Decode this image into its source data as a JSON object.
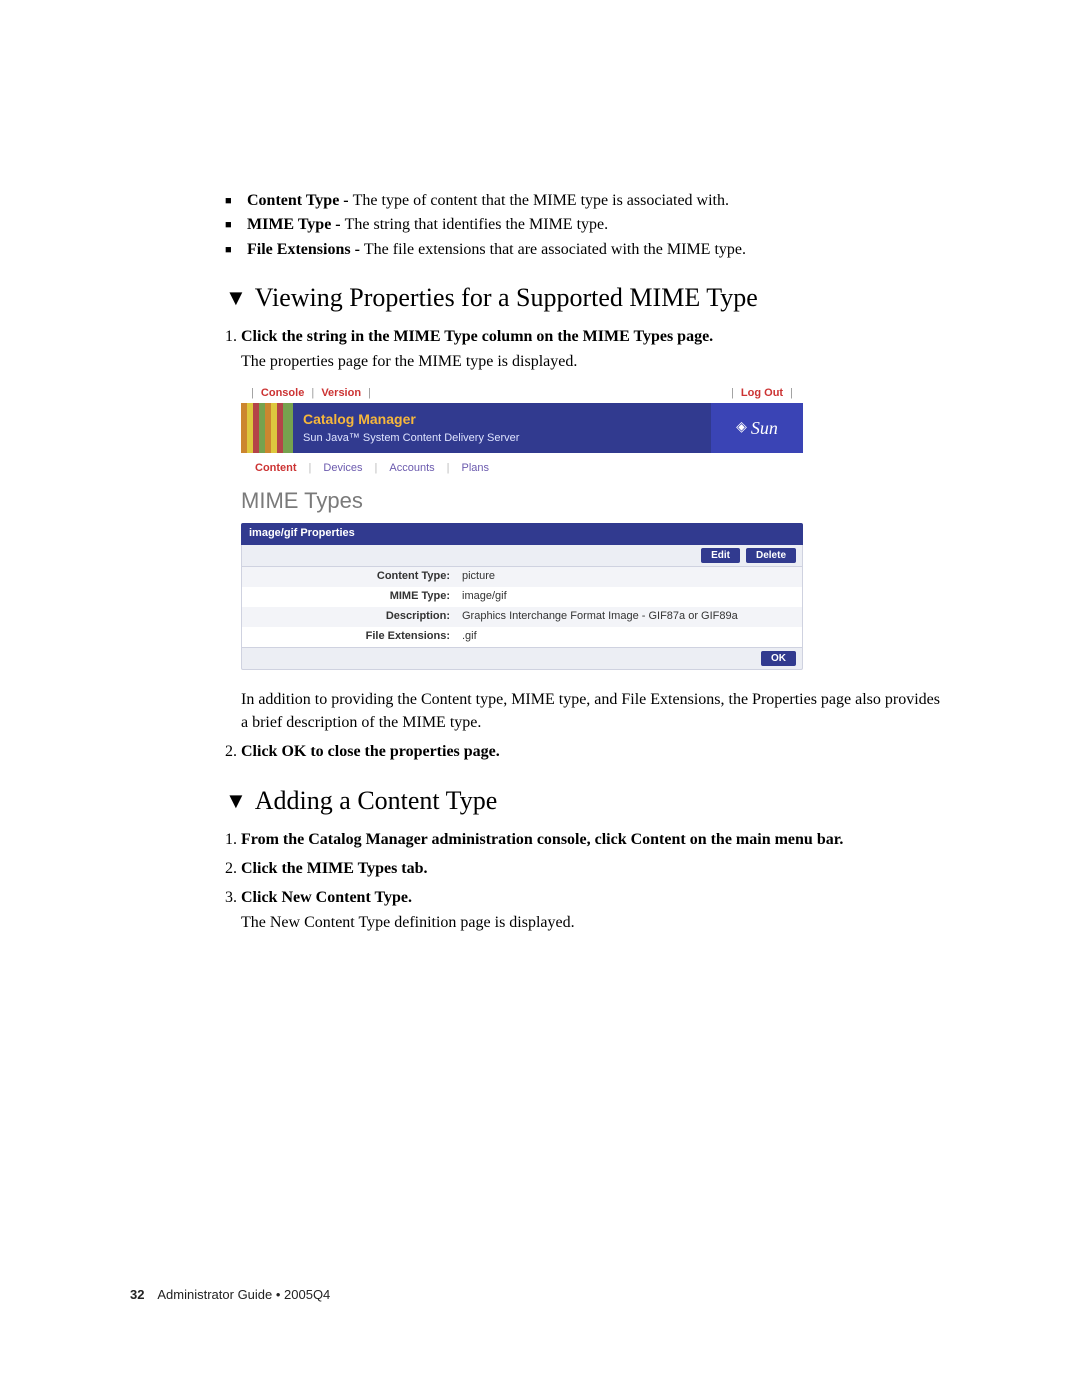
{
  "bullets": [
    {
      "label": "Content Type - ",
      "text": "The type of content that the MIME type is associated with."
    },
    {
      "label": "MIME Type - ",
      "text": "The string that identifies the MIME type."
    },
    {
      "label": "File Extensions - ",
      "text": "The file extensions that are associated with the MIME type."
    }
  ],
  "section1": {
    "marker": "▼",
    "title": "Viewing Properties for a Supported MIME Type",
    "step1_lead": "Click the string in the MIME Type column on the MIME Types page.",
    "step1_body": "The properties page for the MIME type is displayed.",
    "post_text": "In addition to providing the Content type, MIME type, and File Extensions, the Properties page also provides a brief description of the MIME type.",
    "step2_lead": "Click OK to close the properties page."
  },
  "ui": {
    "top": {
      "console": "Console",
      "version": "Version",
      "logout": "Log Out"
    },
    "masthead": {
      "title": "Catalog Manager",
      "subtitle": "Sun Java™ System Content Delivery Server",
      "logo": "Sun"
    },
    "tabs": {
      "content": "Content",
      "devices": "Devices",
      "accounts": "Accounts",
      "plans": "Plans"
    },
    "page_title": "MIME Types",
    "panel_title": "image/gif Properties",
    "buttons": {
      "edit": "Edit",
      "delete": "Delete",
      "ok": "OK"
    },
    "props": {
      "content_type_k": "Content Type:",
      "content_type_v": "picture",
      "mime_type_k": "MIME Type:",
      "mime_type_v": "image/gif",
      "description_k": "Description:",
      "description_v": "Graphics Interchange Format Image - GIF87a or GIF89a",
      "file_ext_k": "File Extensions:",
      "file_ext_v": ".gif"
    }
  },
  "section2": {
    "marker": "▼",
    "title": "Adding a Content Type",
    "step1_lead": "From the Catalog Manager administration console, click Content on the main menu bar.",
    "step2_lead": "Click the MIME Types tab.",
    "step3_lead": "Click New Content Type.",
    "step3_body": "The New Content Type definition page is displayed."
  },
  "footer": {
    "page": "32",
    "text": "Administrator Guide • 2005Q4"
  }
}
